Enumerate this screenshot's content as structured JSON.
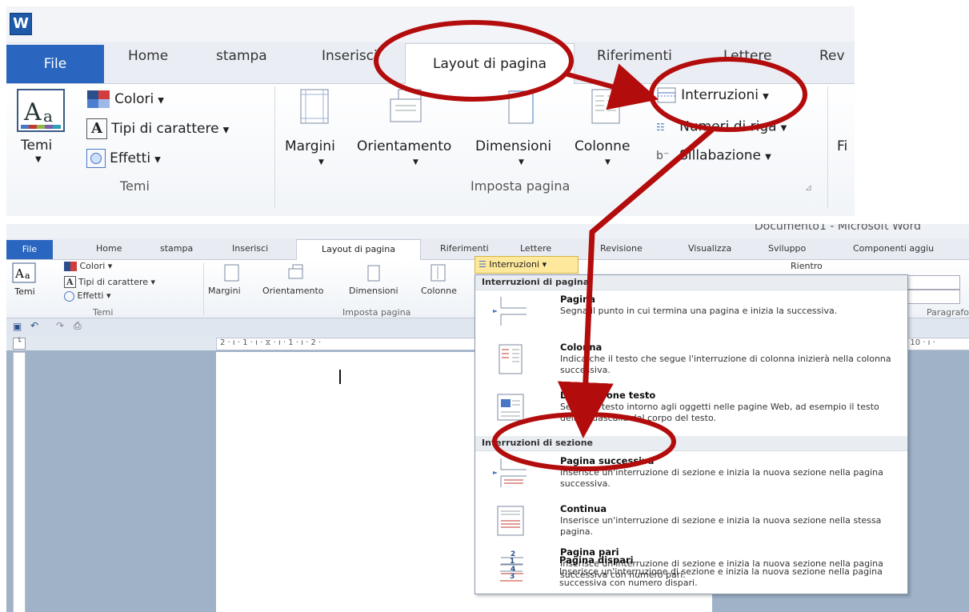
{
  "zoom": {
    "app_icon": "W",
    "tabs": {
      "file": "File",
      "home": "Home",
      "stampa": "stampa",
      "inserisci": "Inserisci",
      "layout": "Layout di pagina",
      "riferimenti": "Riferimenti",
      "lettere": "Lettere",
      "rev": "Rev"
    },
    "temi": {
      "button": "Temi",
      "colori": "Colori",
      "tipi": "Tipi di carattere",
      "effetti": "Effetti",
      "group": "Temi"
    },
    "imposta": {
      "margini": "Margini",
      "orientamento": "Orientamento",
      "dimensioni": "Dimensioni",
      "colonne": "Colonne",
      "group": "Imposta pagina"
    },
    "right": {
      "interruzioni": "Interruzioni",
      "numeri": "Numeri di riga",
      "sillabazione": "Sillabazione",
      "fi": "Fi"
    }
  },
  "full": {
    "doc_title": "Documento1 - Microsoft Word",
    "tabs": {
      "file": "File",
      "home": "Home",
      "stampa": "stampa",
      "inserisci": "Inserisci",
      "layout": "Layout di pagina",
      "riferimenti": "Riferimenti",
      "lettere": "Lettere",
      "revisione": "Revisione",
      "visualizza": "Visualizza",
      "sviluppo": "Sviluppo",
      "componenti": "Componenti aggiu"
    },
    "temi": {
      "button": "Temi",
      "colori": "Colori",
      "tipi": "Tipi di carattere",
      "effetti": "Effetti",
      "group": "Temi"
    },
    "imposta": {
      "margini": "Margini",
      "orientamento": "Orientamento",
      "dimensioni": "Dimensioni",
      "colonne": "Colonne",
      "group": "Imposta pagina"
    },
    "interruzioni_button": "Interruzioni",
    "rientro": "Rientro",
    "paragrafo": "Paragrafo",
    "ruler_text": "2 · ı · 1 · ı · ⧖ · ı · 1 · ı · 2 ·",
    "ruler_right": "· 10 · ı ·"
  },
  "menu": {
    "section1": "Interruzioni di pagina",
    "section2": "Interruzioni di sezione",
    "items": [
      {
        "title": "Pagina",
        "desc": "Segna il punto in cui termina una pagina e inizia la successiva."
      },
      {
        "title": "Colonna",
        "desc": "Indica che il testo che segue l'interruzione di colonna inizierà nella colonna successiva."
      },
      {
        "title": "Disposizione testo",
        "desc": "Separa il testo intorno agli oggetti nelle pagine Web, ad esempio il testo della didascalia dal corpo del testo."
      },
      {
        "title": "Pagina successiva",
        "desc": "Inserisce un'interruzione di sezione e inizia la nuova sezione nella pagina successiva."
      },
      {
        "title": "Continua",
        "desc": "Inserisce un'interruzione di sezione e inizia la nuova sezione nella stessa pagina."
      },
      {
        "title": "Pagina pari",
        "desc": "Inserisce un'interruzione di sezione e inizia la nuova sezione nella pagina successiva con numero pari."
      },
      {
        "title": "Pagina dispari",
        "desc": "Inserisce un'interruzione di sezione e inizia la nuova sezione nella pagina successiva con numero dispari."
      }
    ]
  },
  "colors": {
    "file_tab": "#2a66c0",
    "annotation": "#b30c0c",
    "highlight": "#fde89b"
  }
}
